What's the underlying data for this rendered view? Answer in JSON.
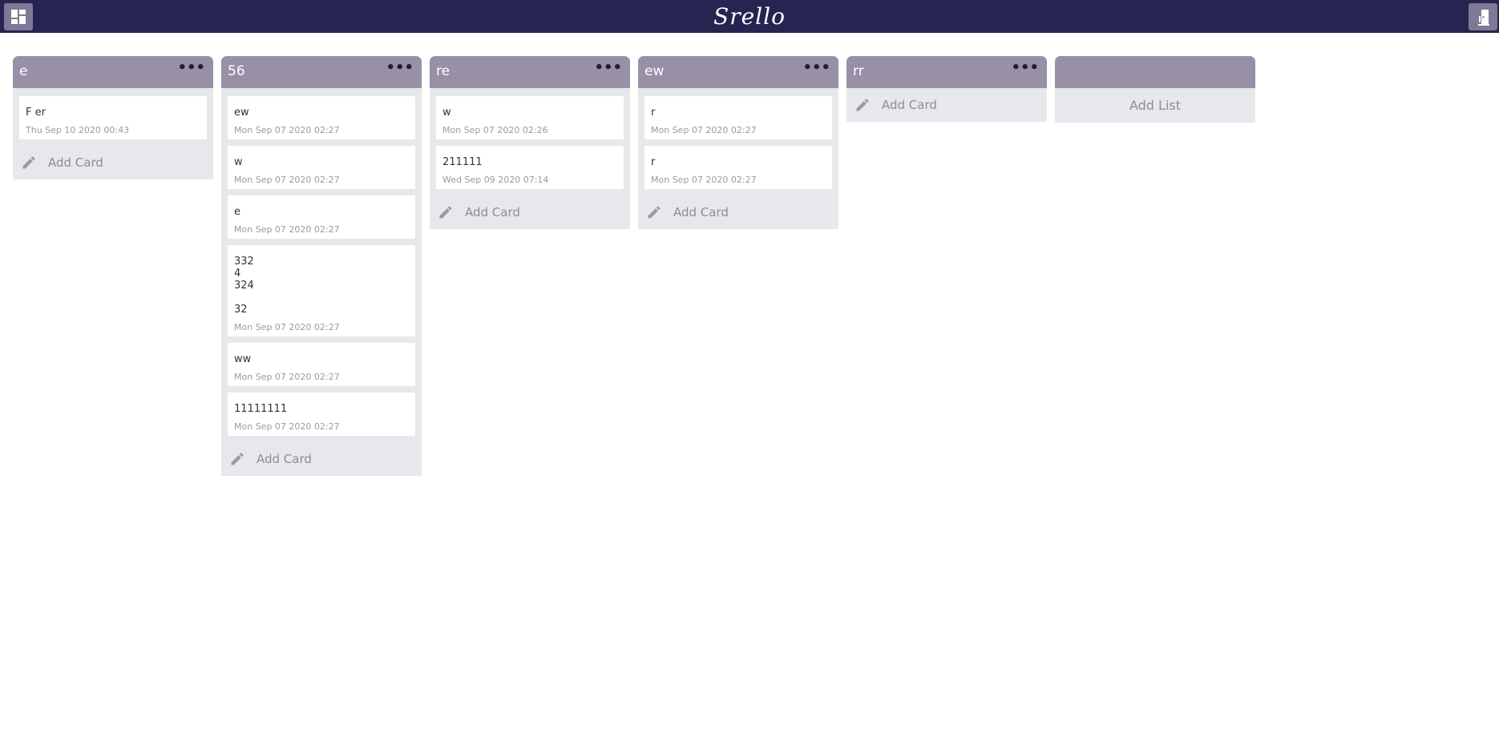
{
  "app": {
    "logo": "Srello",
    "left_icon": "dashboard-icon",
    "right_icon": "logout-door-icon"
  },
  "lists": [
    {
      "title": "e",
      "menu": "•••",
      "add_label": "Add Card",
      "cards": [
        {
          "text": "F er",
          "date": "Thu Sep 10 2020 00:43"
        }
      ]
    },
    {
      "title": "56",
      "menu": "•••",
      "add_label": "Add Card",
      "cards": [
        {
          "text": "ew",
          "date": "Mon Sep 07 2020 02:27"
        },
        {
          "text": "w",
          "date": "Mon Sep 07 2020 02:27"
        },
        {
          "text": "e",
          "date": "Mon Sep 07 2020 02:27"
        },
        {
          "text": "332\n4\n324\n\n32",
          "date": "Mon Sep 07 2020 02:27"
        },
        {
          "text": "ww",
          "date": "Mon Sep 07 2020 02:27"
        },
        {
          "text": "11111111",
          "date": "Mon Sep 07 2020 02:27"
        }
      ]
    },
    {
      "title": "re",
      "menu": "•••",
      "add_label": "Add Card",
      "cards": [
        {
          "text": "w",
          "date": "Mon Sep 07 2020 02:26"
        },
        {
          "text": "211111",
          "date": "Wed Sep 09 2020 07:14"
        }
      ]
    },
    {
      "title": "ew",
      "menu": "•••",
      "add_label": "Add Card",
      "cards": [
        {
          "text": "r",
          "date": "Mon Sep 07 2020 02:27"
        },
        {
          "text": "r",
          "date": "Mon Sep 07 2020 02:27"
        }
      ]
    },
    {
      "title": "rr",
      "menu": "•••",
      "add_label": "Add Card",
      "cards": []
    }
  ],
  "add_list_label": "Add List",
  "colors": {
    "topbar": "#272452",
    "list_header": "#9890a7",
    "list_body": "#e7e8ec"
  }
}
